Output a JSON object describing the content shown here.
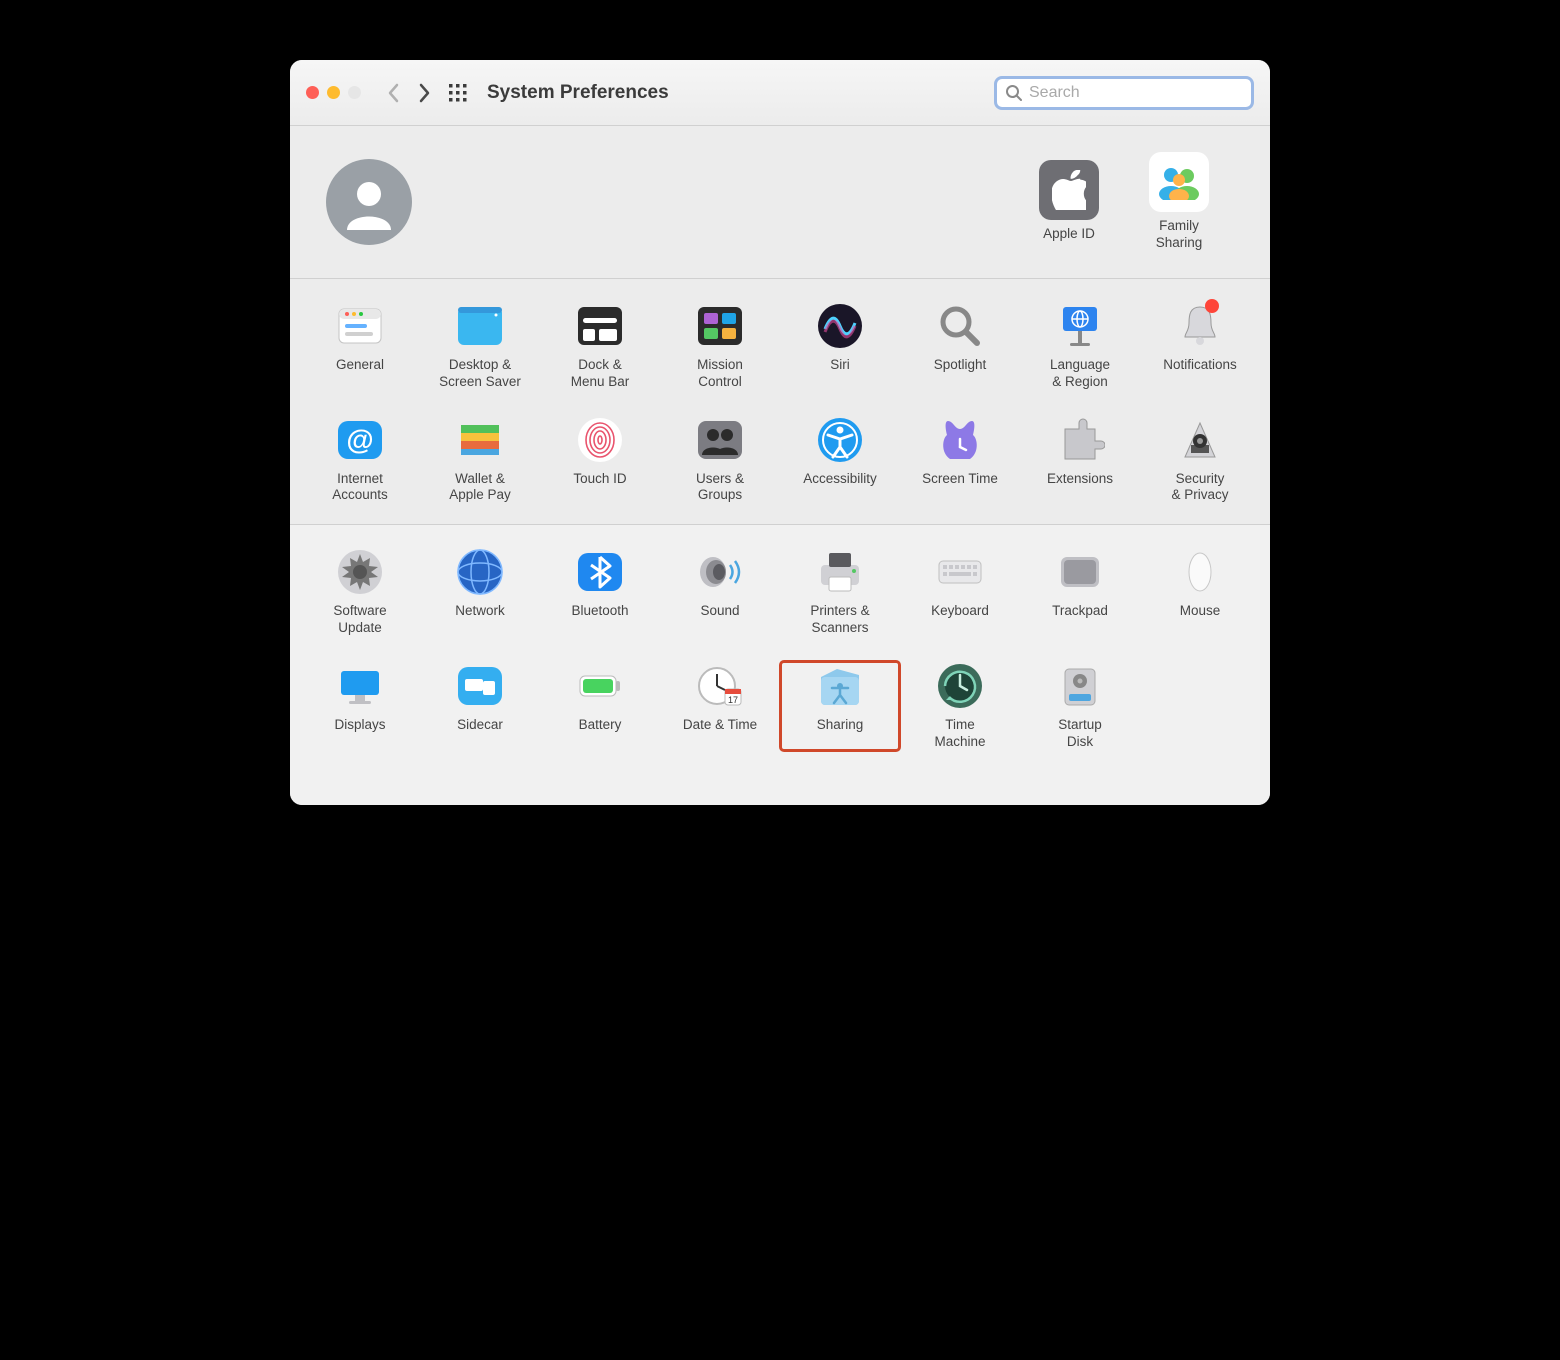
{
  "window": {
    "title": "System Preferences"
  },
  "search": {
    "placeholder": "Search"
  },
  "profile": {
    "apple_id_label": "Apple ID",
    "family_label": "Family\nSharing"
  },
  "panes_a": [
    {
      "id": "general",
      "label": "General"
    },
    {
      "id": "desktop",
      "label": "Desktop &\nScreen Saver"
    },
    {
      "id": "dock",
      "label": "Dock &\nMenu Bar"
    },
    {
      "id": "mission",
      "label": "Mission\nControl"
    },
    {
      "id": "siri",
      "label": "Siri"
    },
    {
      "id": "spotlight",
      "label": "Spotlight"
    },
    {
      "id": "language",
      "label": "Language\n& Region"
    },
    {
      "id": "notifications",
      "label": "Notifications"
    },
    {
      "id": "internet",
      "label": "Internet\nAccounts"
    },
    {
      "id": "wallet",
      "label": "Wallet &\nApple Pay"
    },
    {
      "id": "touchid",
      "label": "Touch ID"
    },
    {
      "id": "users",
      "label": "Users &\nGroups"
    },
    {
      "id": "accessibility",
      "label": "Accessibility"
    },
    {
      "id": "screentime",
      "label": "Screen Time"
    },
    {
      "id": "extensions",
      "label": "Extensions"
    },
    {
      "id": "security",
      "label": "Security\n& Privacy"
    }
  ],
  "panes_b": [
    {
      "id": "software",
      "label": "Software\nUpdate"
    },
    {
      "id": "network",
      "label": "Network"
    },
    {
      "id": "bluetooth",
      "label": "Bluetooth"
    },
    {
      "id": "sound",
      "label": "Sound"
    },
    {
      "id": "printers",
      "label": "Printers &\nScanners"
    },
    {
      "id": "keyboard",
      "label": "Keyboard"
    },
    {
      "id": "trackpad",
      "label": "Trackpad"
    },
    {
      "id": "mouse",
      "label": "Mouse"
    },
    {
      "id": "displays",
      "label": "Displays"
    },
    {
      "id": "sidecar",
      "label": "Sidecar"
    },
    {
      "id": "battery",
      "label": "Battery"
    },
    {
      "id": "datetime",
      "label": "Date & Time"
    },
    {
      "id": "sharing",
      "label": "Sharing",
      "highlighted": true
    },
    {
      "id": "timemachine",
      "label": "Time\nMachine"
    },
    {
      "id": "startup",
      "label": "Startup\nDisk"
    }
  ]
}
